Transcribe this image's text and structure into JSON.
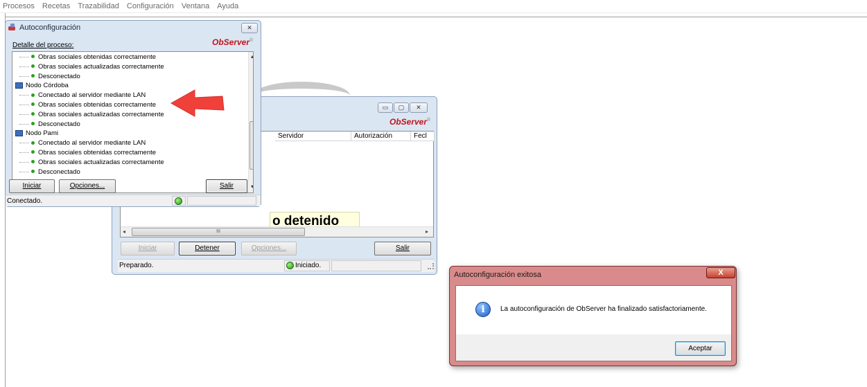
{
  "menu": [
    "Procesos",
    "Recetas",
    "Trazabilidad",
    "Configuración",
    "Ventana",
    "Ayuda"
  ],
  "main_window": {
    "logo": "ObServer",
    "logo_mark": "®",
    "columns": [
      "Servidor",
      "Autorización",
      "Fecl"
    ],
    "banner": "o detenido",
    "buttons": {
      "iniciar": "Iniciar",
      "detener": "Detener",
      "opciones": "Opciones...",
      "salir": "Salir"
    },
    "status_left": "Preparado.",
    "status_state": "Iniciado.",
    "scroll_grip": "III",
    "min_glyph": "▭",
    "max_glyph": "▢",
    "close_glyph": "✕"
  },
  "autoconfig_window": {
    "title": "Autoconfiguración",
    "logo": "ObServer",
    "logo_mark": "®",
    "detail_label": "Detalle del proceso:",
    "close_glyph": "✕",
    "tree": [
      {
        "type": "item",
        "text": "Obras sociales obtenidas correctamente"
      },
      {
        "type": "item",
        "text": "Obras sociales actualizadas correctamente"
      },
      {
        "type": "item",
        "text": "Desconectado"
      },
      {
        "type": "node",
        "text": "Nodo Córdoba"
      },
      {
        "type": "item",
        "text": "Conectado al servidor mediante LAN"
      },
      {
        "type": "item",
        "text": "Obras sociales obtenidas correctamente"
      },
      {
        "type": "item",
        "text": "Obras sociales actualizadas correctamente"
      },
      {
        "type": "item",
        "text": "Desconectado"
      },
      {
        "type": "node",
        "text": "Nodo Pami"
      },
      {
        "type": "item",
        "text": "Conectado al servidor mediante LAN"
      },
      {
        "type": "item",
        "text": "Obras sociales obtenidas correctamente"
      },
      {
        "type": "item",
        "text": "Obras sociales actualizadas correctamente"
      },
      {
        "type": "item",
        "text": "Desconectado"
      }
    ],
    "buttons": {
      "iniciar": "Iniciar",
      "opciones": "Opciones...",
      "salir": "Salir"
    },
    "status": "Conectado."
  },
  "dialog": {
    "title": "Autoconfiguración exitosa",
    "close_glyph": "X",
    "info_glyph": "i",
    "message": "La autoconfiguración de ObServer ha finalizado satisfactoriamente.",
    "ok": "Aceptar"
  },
  "colors": {
    "logo_red": "#c0151b",
    "status_green": "#1c9a10",
    "arrow_red": "#f0403a",
    "dialog_frame": "#d98a8a"
  }
}
